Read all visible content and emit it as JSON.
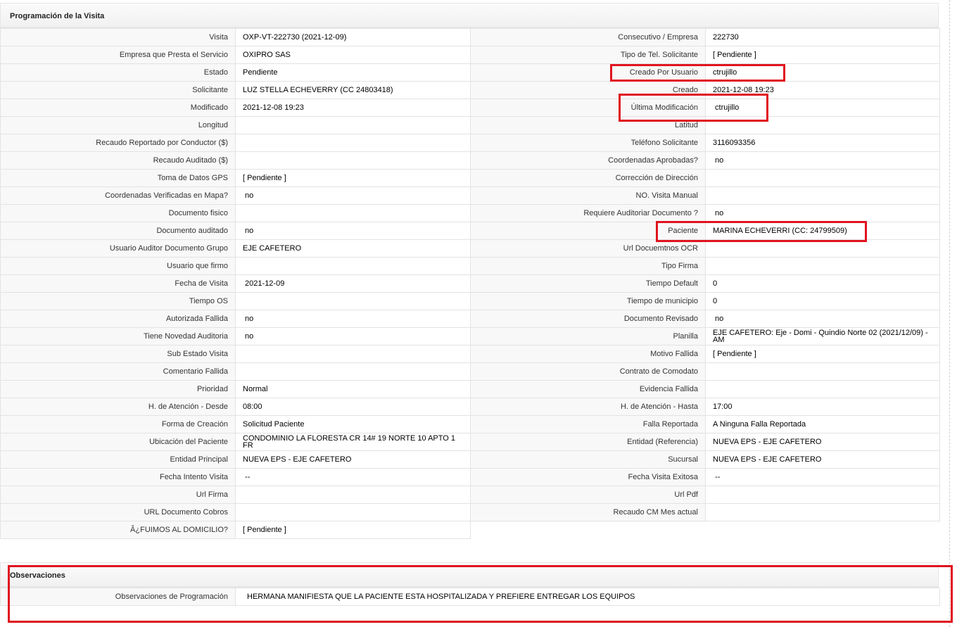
{
  "programacion": {
    "title": "Programación de la Visita",
    "left": [
      {
        "label": "Visita",
        "value": "OXP-VT-222730 (2021-12-09)"
      },
      {
        "label": "Empresa que Presta el Servicio",
        "value": "OXIPRO SAS"
      },
      {
        "label": "Estado",
        "value": "Pendiente"
      },
      {
        "label": "Solicitante",
        "value": "LUZ STELLA ECHEVERRY (CC 24803418)"
      },
      {
        "label": "Modificado",
        "value": "2021-12-08 19:23"
      },
      {
        "label": "Longitud",
        "value": ""
      },
      {
        "label": "Recaudo Reportado por Conductor ($)",
        "value": ""
      },
      {
        "label": "Recaudo Auditado ($)",
        "value": ""
      },
      {
        "label": "Toma de Datos GPS",
        "value": "[ Pendiente ]"
      },
      {
        "label": "Coordenadas Verificadas en Mapa?",
        "value": " no"
      },
      {
        "label": "Documento fisico",
        "value": ""
      },
      {
        "label": "Documento auditado",
        "value": " no"
      },
      {
        "label": "Usuario Auditor Documento Grupo",
        "value": "EJE CAFETERO"
      },
      {
        "label": "Usuario que firmo",
        "value": ""
      },
      {
        "label": "Fecha de Visita",
        "value": " 2021-12-09"
      },
      {
        "label": "Tiempo OS",
        "value": ""
      },
      {
        "label": "Autorizada Fallida",
        "value": " no"
      },
      {
        "label": "Tiene Novedad Auditoria",
        "value": " no"
      },
      {
        "label": "Sub Estado Visita",
        "value": ""
      },
      {
        "label": "Comentario Fallida",
        "value": ""
      },
      {
        "label": "Prioridad",
        "value": "Normal"
      },
      {
        "label": "H. de Atención - Desde",
        "value": "08:00"
      },
      {
        "label": "Forma de Creación",
        "value": "Solicitud Paciente"
      },
      {
        "label": "Ubicación del Paciente",
        "value": "CONDOMINIO LA FLORESTA CR 14# 19 NORTE 10 APTO 1 FR"
      },
      {
        "label": "Entidad Principal",
        "value": "NUEVA EPS - EJE CAFETERO"
      },
      {
        "label": "Fecha Intento Visita",
        "value": " --"
      },
      {
        "label": "Url Firma",
        "value": ""
      },
      {
        "label": "URL Documento Cobros",
        "value": ""
      },
      {
        "label": "Â¿FUIMOS AL DOMICILIO?",
        "value": "[ Pendiente ]"
      }
    ],
    "right": [
      {
        "label": "Consecutivo / Empresa",
        "value": "222730"
      },
      {
        "label": "Tipo de Tel. Solicitante",
        "value": "[ Pendiente ]"
      },
      {
        "label": "Creado Por Usuario",
        "value": "ctrujillo"
      },
      {
        "label": "Creado",
        "value": "2021-12-08 19:23"
      },
      {
        "label": "Última Modificación",
        "value": " ctrujillo"
      },
      {
        "label": "Latitud",
        "value": ""
      },
      {
        "label": "Teléfono Solicitante",
        "value": "3116093356"
      },
      {
        "label": "Coordenadas Aprobadas?",
        "value": " no"
      },
      {
        "label": "Corrección de Dirección",
        "value": ""
      },
      {
        "label": "NO. Visita Manual",
        "value": ""
      },
      {
        "label": "Requiere Auditoriar Documento ?",
        "value": " no"
      },
      {
        "label": "Paciente",
        "value": "MARINA ECHEVERRI (CC: 24799509)"
      },
      {
        "label": "Url Docuemtnos OCR",
        "value": ""
      },
      {
        "label": "Tipo Firma",
        "value": ""
      },
      {
        "label": "Tiempo Default",
        "value": "0"
      },
      {
        "label": "Tiempo de municipio",
        "value": "0"
      },
      {
        "label": "Documento Revisado",
        "value": " no"
      },
      {
        "label": "Planilla",
        "value": "EJE CAFETERO: Eje - Domi - Quindio Norte 02 (2021/12/09) - AM"
      },
      {
        "label": "Motivo Fallida",
        "value": "[ Pendiente ]"
      },
      {
        "label": "Contrato de Comodato",
        "value": ""
      },
      {
        "label": "Evidencia Fallida",
        "value": ""
      },
      {
        "label": "H. de Atención - Hasta",
        "value": "17:00"
      },
      {
        "label": "Falla Reportada",
        "value": "A Ninguna Falla Reportada"
      },
      {
        "label": "Entidad (Referencia)",
        "value": "NUEVA EPS - EJE CAFETERO"
      },
      {
        "label": "Sucursal",
        "value": "NUEVA EPS - EJE CAFETERO"
      },
      {
        "label": "Fecha Visita Exitosa",
        "value": " --"
      },
      {
        "label": "Url Pdf",
        "value": ""
      },
      {
        "label": "Recaudo CM Mes actual",
        "value": ""
      }
    ]
  },
  "observaciones": {
    "title": "Observaciones",
    "label": "Observaciones de Programación",
    "value": "HERMANA MANIFIESTA QUE LA PACIENTE ESTA HOSPITALIZADA Y PREFIERE ENTREGAR LOS EQUIPOS"
  },
  "colors": {
    "highlight": "#e0141e",
    "header_bg": "#f1f1f1",
    "label_bg": "#f8f8f8",
    "border": "#e3e3e3"
  }
}
